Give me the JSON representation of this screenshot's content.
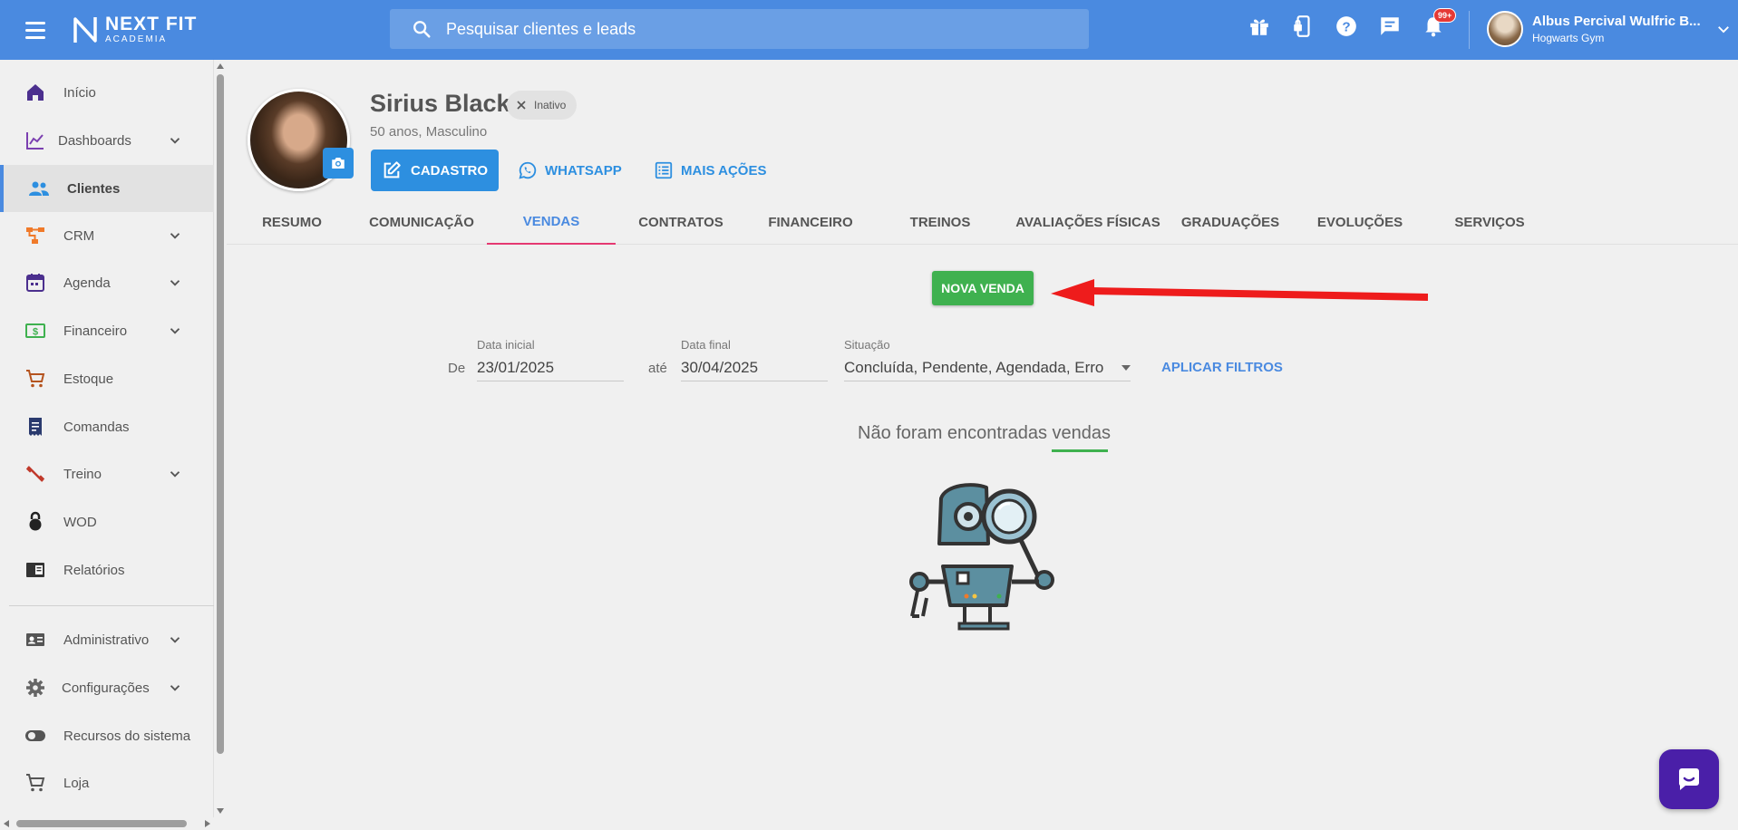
{
  "app": {
    "logo_main": "NEXT FIT",
    "logo_sub": "ACADEMIA",
    "search_placeholder": "Pesquisar clientes e leads",
    "notification_count": "99+",
    "user_name": "Albus Percival Wulfric B...",
    "user_gym": "Hogwarts Gym"
  },
  "colors": {
    "topbar": "#4a8ae0",
    "primary": "#2d8fe0",
    "success": "#3fb14f",
    "tab_indicator": "#e53972",
    "arrow": "#ee1c1c",
    "chat": "#4a1fa8"
  },
  "sidebar": {
    "items": [
      {
        "label": "Início",
        "icon": "home-icon",
        "has_children": false
      },
      {
        "label": "Dashboards",
        "icon": "chart-line-icon",
        "has_children": true
      },
      {
        "label": "Clientes",
        "icon": "people-icon",
        "has_children": false,
        "active": true
      },
      {
        "label": "CRM",
        "icon": "crm-flow-icon",
        "has_children": true
      },
      {
        "label": "Agenda",
        "icon": "calendar-icon",
        "has_children": true
      },
      {
        "label": "Financeiro",
        "icon": "money-icon",
        "has_children": true
      },
      {
        "label": "Estoque",
        "icon": "cart-icon",
        "has_children": false
      },
      {
        "label": "Comandas",
        "icon": "receipt-icon",
        "has_children": false
      },
      {
        "label": "Treino",
        "icon": "dumbbell-icon",
        "has_children": true
      },
      {
        "label": "WOD",
        "icon": "kettlebell-icon",
        "has_children": false
      },
      {
        "label": "Relatórios",
        "icon": "report-icon",
        "has_children": false
      },
      {
        "label": "Administrativo",
        "icon": "id-card-icon",
        "has_children": true
      },
      {
        "label": "Configurações",
        "icon": "gear-icon",
        "has_children": true
      },
      {
        "label": "Recursos do sistema",
        "icon": "toggle-icon",
        "has_children": false
      },
      {
        "label": "Loja",
        "icon": "cart-icon",
        "has_children": false
      }
    ]
  },
  "client": {
    "name": "Sirius Black",
    "status": "Inativo",
    "meta": "50 anos, Masculino",
    "actions": {
      "cadastro": "CADASTRO",
      "whatsapp": "WHATSAPP",
      "more": "MAIS AÇÕES"
    }
  },
  "tabs": [
    {
      "label": "RESUMO"
    },
    {
      "label": "COMUNICAÇÃO"
    },
    {
      "label": "VENDAS",
      "active": true
    },
    {
      "label": "CONTRATOS"
    },
    {
      "label": "FINANCEIRO"
    },
    {
      "label": "TREINOS"
    },
    {
      "label": "AVALIAÇÕES FÍSICAS"
    },
    {
      "label": "GRADUAÇÕES"
    },
    {
      "label": "EVOLUÇÕES"
    },
    {
      "label": "SERVIÇOS"
    }
  ],
  "sales": {
    "new_sale": "NOVA VENDA",
    "from_label": "De",
    "start_label": "Data inicial",
    "start_value": "23/01/2025",
    "to_label": "até",
    "end_label": "Data final",
    "end_value": "30/04/2025",
    "status_label": "Situação",
    "status_value": "Concluída, Pendente, Agendada, Erro",
    "apply": "APLICAR FILTROS",
    "empty_message": "Não foram encontradas vendas"
  }
}
